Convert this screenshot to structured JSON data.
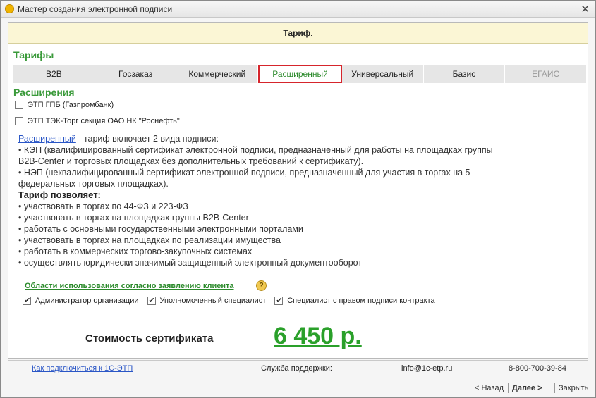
{
  "window": {
    "title": "Мастер создания электронной подписи",
    "close": "✕"
  },
  "header": {
    "title": "Тариф."
  },
  "tariffs": {
    "heading": "Тарифы",
    "tabs": [
      "B2B",
      "Госзаказ",
      "Коммерческий",
      "Расширенный",
      "Универсальный",
      "Базис",
      "ЕГАИС"
    ],
    "active_tab": "Расширенный"
  },
  "extensions": {
    "heading": "Расширения",
    "items": [
      {
        "label": "ЭТП ГПБ (Газпромбанк)",
        "checked": false
      },
      {
        "label": "ЭТП ТЭК-Торг секция ОАО НК \"Роснефть\"",
        "checked": false
      }
    ]
  },
  "description": {
    "link": "Расширенный",
    "intro": " - тариф включает 2 вида подписи:",
    "lines": [
      "• КЭП (квалифицированный сертификат электронной подписи, предназначенный для работы на площадках группы",
      "B2B-Center и торговых площадках без дополнительных требований к сертификату).",
      "• НЭП (неквалифицированный сертификат электронной подписи, предназначенный для участия в торгах на 5",
      "федеральных торговых площадках)."
    ],
    "allows_heading": "Тариф позволяет:",
    "allows": [
      "• участвовать в торгах по 44-ФЗ и 223-ФЗ",
      "• участвовать в торгах на площадках группы B2B-Center",
      "• работать с основными государственными электронными порталами",
      "• участвовать в торгах на площадках по реализации имущества",
      "• работать в коммерческих торгово-закупочных системах",
      "• осуществлять юридически значимый защищенный электронный документооборот"
    ]
  },
  "usage": {
    "title": "Области использования согласно заявлению клиента",
    "help": "?",
    "items": [
      {
        "label": "Администратор организации",
        "checked": true
      },
      {
        "label": "Уполномоченный специалист",
        "checked": true
      },
      {
        "label": "Специалист с правом подписи контракта",
        "checked": true
      }
    ]
  },
  "price": {
    "label": "Стоимость сертификата",
    "value": "6 450 р."
  },
  "footer": {
    "connect_link": "Как подключиться к 1С-ЭТП",
    "support_label": "Служба поддержки:",
    "email": "info@1c-etp.ru",
    "phone": "8-800-700-39-84"
  },
  "nav": {
    "back": "< Назад",
    "next": "Далее >",
    "close": "Закрыть"
  }
}
